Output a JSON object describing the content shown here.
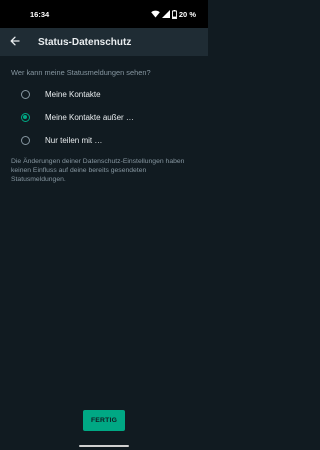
{
  "status_bar": {
    "time": "16:34",
    "battery": "20 %",
    "icons": [
      "wifi-icon",
      "signal-icon",
      "battery-icon"
    ]
  },
  "app_bar": {
    "title": "Status-Datenschutz",
    "back_icon": "arrow-left-icon"
  },
  "question": "Wer kann meine Statusmeldungen sehen?",
  "options": [
    {
      "label": "Meine Kontakte",
      "selected": false
    },
    {
      "label": "Meine Kontakte außer …",
      "selected": true
    },
    {
      "label": "Nur teilen mit …",
      "selected": false
    }
  ],
  "note": "Die Änderungen deiner Datenschutz-Einstellungen haben keinen Einfluss auf deine bereits gesendeten Statusmeldungen.",
  "done_button": "FERTIG",
  "colors": {
    "background": "#111b21",
    "app_bar": "#1f2c34",
    "accent": "#00a884",
    "secondary_text": "#8696a0",
    "primary_text": "#e9edef"
  }
}
